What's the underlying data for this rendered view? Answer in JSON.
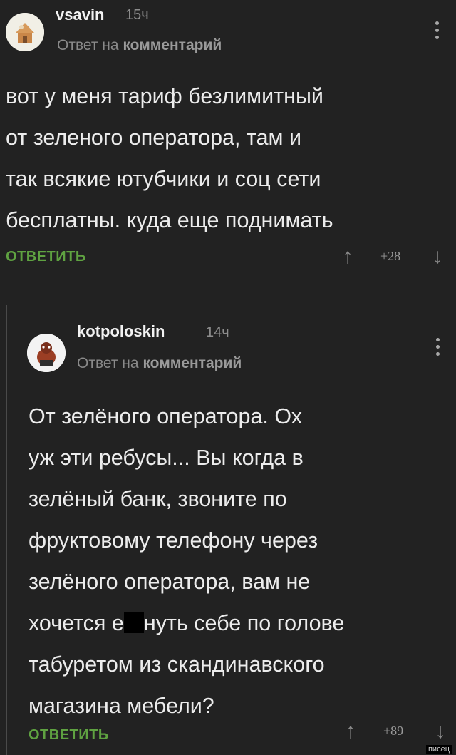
{
  "comments": [
    {
      "username": "vsavin",
      "time": "15ч",
      "reply_prefix": "Ответ на",
      "reply_target": "комментарий",
      "body_lines": [
        "вот у меня тариф безлимитный",
        "от зеленого оператора, там и",
        "так всякие ютубчики и соц сети",
        "бесплатны. куда еще поднимать"
      ],
      "reply_label": "ОТВЕТИТЬ",
      "score": "+28"
    },
    {
      "username": "kotpoloskin",
      "time": "14ч",
      "reply_prefix": "Ответ на",
      "reply_target": "комментарий",
      "body_lines": [
        "От зелёного оператора. Ох",
        "уж эти ребусы... Вы когда в",
        "зелёный банк, звоните по",
        "фруктовому телефону через",
        "зелёного оператора, вам не",
        "хочется е",
        "нуть себе по голове",
        "табуретом из скандинавского",
        "магазина мебели?"
      ],
      "reply_label": "ОТВЕТИТЬ",
      "score": "+89"
    }
  ],
  "watermark": "писец",
  "colors": {
    "background": "#222222",
    "accent_green": "#5fa241",
    "text": "#ececec",
    "muted": "#8a8a8a"
  }
}
